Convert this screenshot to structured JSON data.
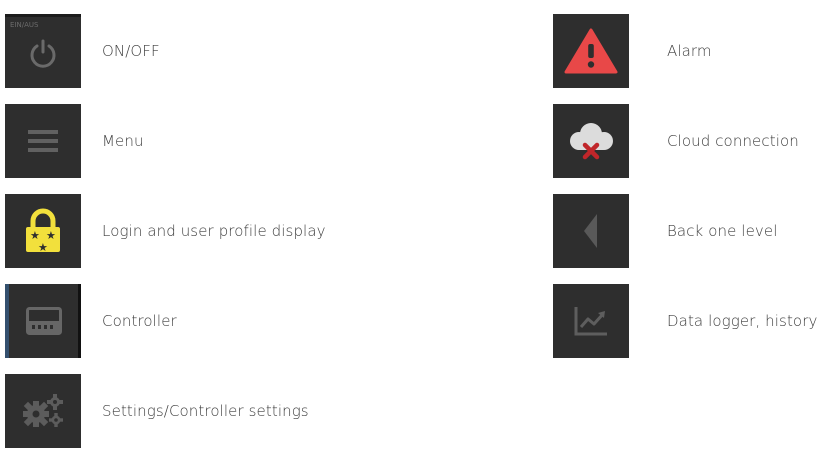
{
  "left_column": [
    {
      "icon": "power-icon",
      "tile_text": "EIN/AUS",
      "label": "ON/OFF"
    },
    {
      "icon": "hamburger-menu-icon",
      "label": "Menu"
    },
    {
      "icon": "padlock-icon",
      "label": "Login and user profile display"
    },
    {
      "icon": "controller-display-icon",
      "label": "Controller"
    },
    {
      "icon": "gears-icon",
      "label": "Settings/Controller settings"
    }
  ],
  "right_column": [
    {
      "icon": "alarm-triangle-icon",
      "label": "Alarm"
    },
    {
      "icon": "cloud-disconnected-icon",
      "label": "Cloud connection"
    },
    {
      "icon": "back-arrow-icon",
      "label": "Back one level"
    },
    {
      "icon": "chart-trend-icon",
      "label": "Data logger, history"
    }
  ],
  "colors": {
    "tile_background": "#2e2e2e",
    "icon_gray": "#666666",
    "alarm_red": "#e84848",
    "lock_yellow": "#f2e03c",
    "cloud_x_red": "#c0262a",
    "controller_edge_blue": "#34506e"
  }
}
